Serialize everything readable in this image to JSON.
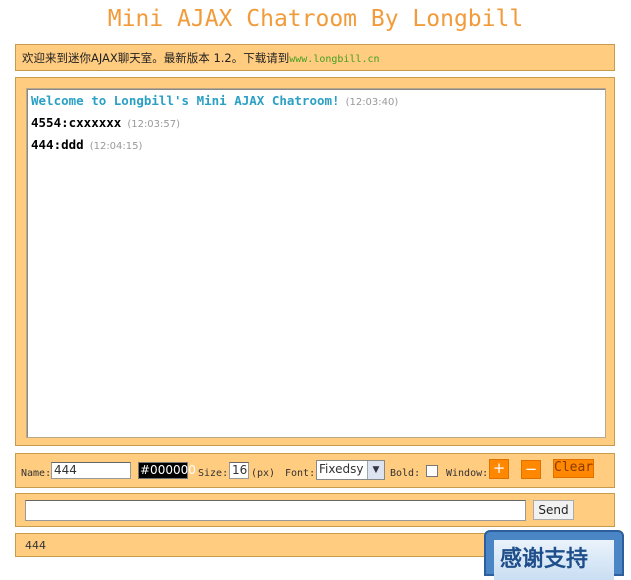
{
  "app": {
    "title": "Mini AJAX Chatroom By Longbill"
  },
  "notice": {
    "text": "欢迎来到迷你AJAX聊天室。最新版本 1.2。下载请到",
    "link": "www.longbill.cn"
  },
  "messages": [
    {
      "text": "Welcome to Longbill's Mini AJAX Chatroom!",
      "time": "(12:03:40)"
    },
    {
      "text": "4554:cxxxxxx",
      "time": "(12:03:57)"
    },
    {
      "text": "444:ddd",
      "time": "(12:04:15)"
    }
  ],
  "controls": {
    "name_label": "Name:",
    "name_value": "444",
    "color_value": "#000000",
    "size_label": "Size:",
    "size_value": "16",
    "size_unit": "(px)",
    "font_label": "Font:",
    "font_value": "Fixedsy",
    "bold_label": "Bold:",
    "bold_checked": false,
    "window_label": "Window:",
    "plus_label": "+",
    "minus_label": "−",
    "clear_label": "Clear"
  },
  "input": {
    "value": "",
    "send_label": "Send"
  },
  "status": {
    "text": "444"
  },
  "banner": {
    "text": "感谢支持"
  },
  "colors": {
    "accent": "#f29b3b",
    "panel": "#ffcc80",
    "welcome": "#2aa0c4",
    "button": "#ff8800"
  }
}
